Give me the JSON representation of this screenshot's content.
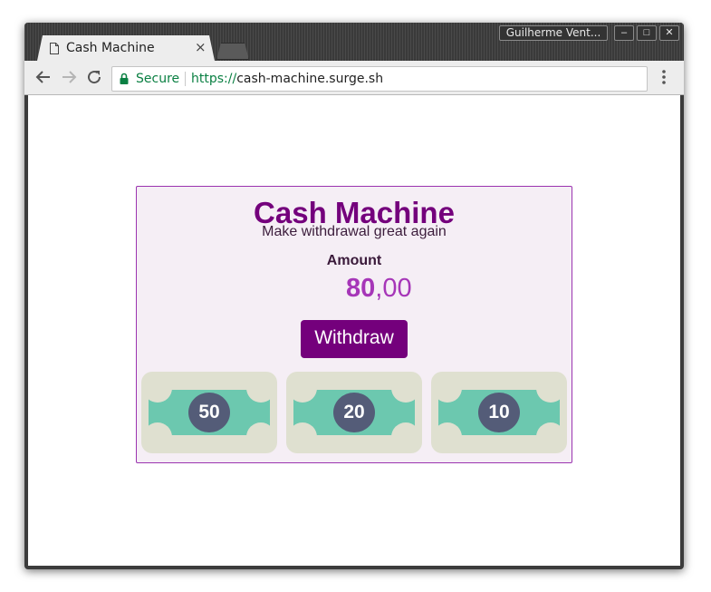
{
  "browser": {
    "tab_title": "Cash Machine",
    "tab_close": "×",
    "profile_name": "Guilherme Vent...",
    "window_buttons": {
      "minimize": "–",
      "maximize": "□",
      "close": "✕"
    },
    "secure_label": "Secure",
    "url_scheme": "https://",
    "url_host": "cash-machine.surge.sh",
    "secure_color": "#0b8043"
  },
  "app": {
    "title": "Cash Machine",
    "subtitle": "Make withdrawal great again",
    "amount_label": "Amount",
    "amount_whole": "80",
    "amount_decimal": ",00",
    "withdraw_label": "Withdraw",
    "notes": [
      {
        "value": "50"
      },
      {
        "value": "20"
      },
      {
        "value": "10"
      }
    ],
    "colors": {
      "primary": "#74007c",
      "amount": "#a636b8",
      "card_background": "#f5eef5",
      "note_green": "#6cc8af",
      "note_border": "#dfe0d0",
      "note_badge": "#545c78"
    }
  }
}
